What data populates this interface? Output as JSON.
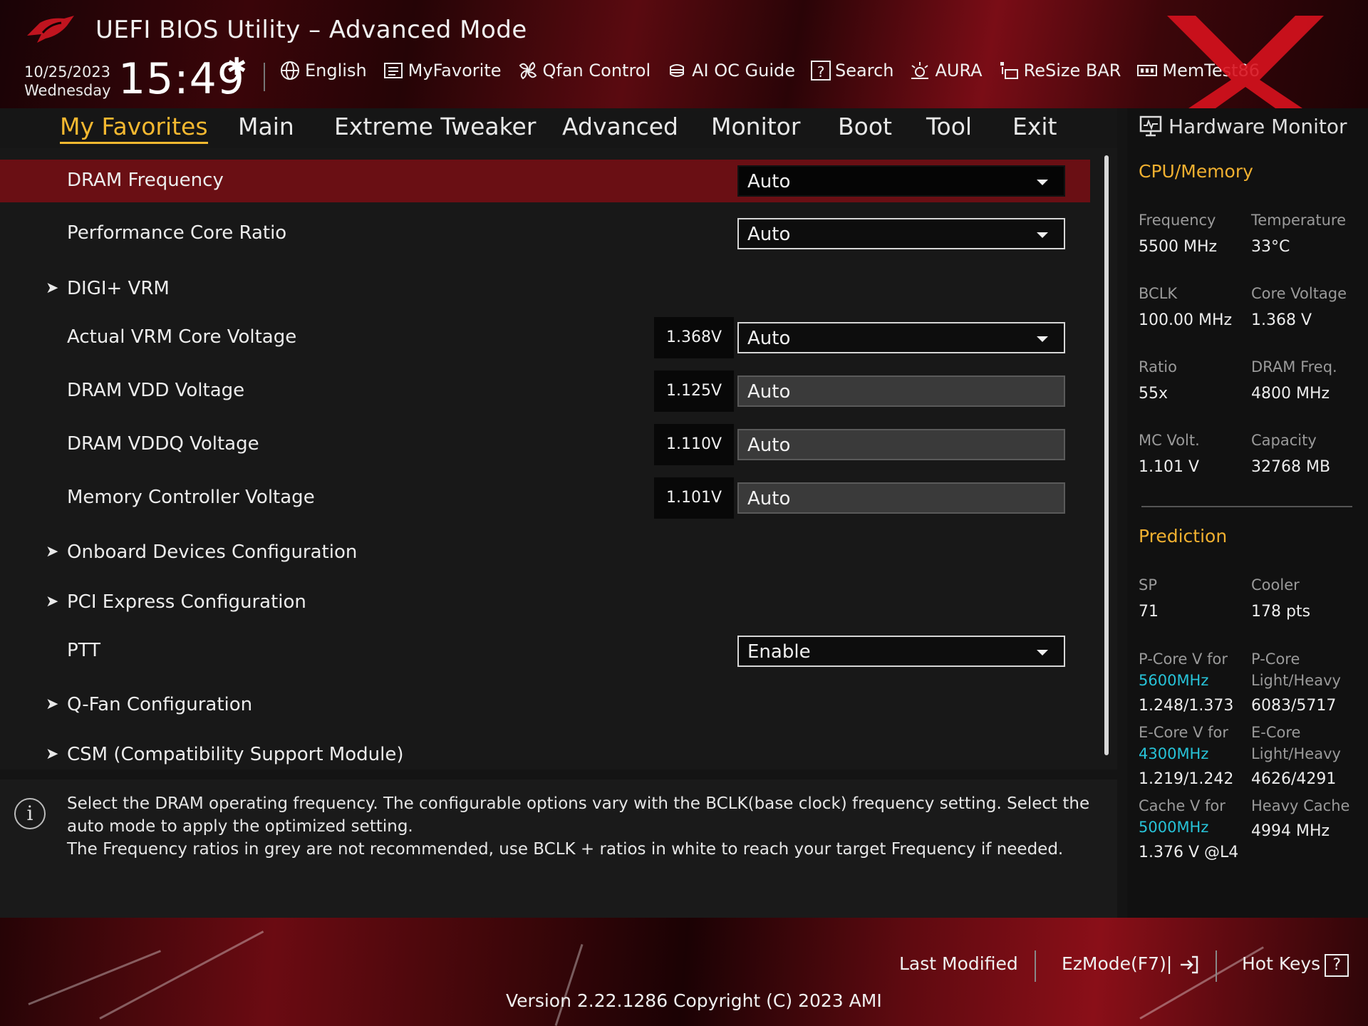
{
  "header": {
    "title": "UEFI BIOS Utility – Advanced Mode",
    "date": "10/25/2023",
    "weekday": "Wednesday",
    "time": "15:49",
    "toolbar": {
      "language": "English",
      "myfavorite": "MyFavorite",
      "qfan": "Qfan Control",
      "aioc": "AI OC Guide",
      "search": "Search",
      "aura": "AURA",
      "resizebar": "ReSize BAR",
      "memtest": "MemTest86"
    }
  },
  "tabs": [
    "My Favorites",
    "Main",
    "Extreme Tweaker",
    "Advanced",
    "Monitor",
    "Boot",
    "Tool",
    "Exit"
  ],
  "settings": {
    "dram_frequency": {
      "label": "DRAM Frequency",
      "value": "Auto"
    },
    "perf_core_ratio": {
      "label": "Performance Core Ratio",
      "value": "Auto"
    },
    "digi_vrm": {
      "label": "DIGI+ VRM"
    },
    "vrm_core_voltage": {
      "label": "Actual VRM Core Voltage",
      "reading": "1.368V",
      "value": "Auto"
    },
    "dram_vdd": {
      "label": "DRAM VDD Voltage",
      "reading": "1.125V",
      "value": "Auto"
    },
    "dram_vddq": {
      "label": "DRAM VDDQ Voltage",
      "reading": "1.110V",
      "value": "Auto"
    },
    "mc_voltage": {
      "label": "Memory Controller Voltage",
      "reading": "1.101V",
      "value": "Auto"
    },
    "onboard_devices": {
      "label": "Onboard Devices Configuration"
    },
    "pci_express": {
      "label": "PCI Express Configuration"
    },
    "ptt": {
      "label": "PTT",
      "value": "Enable"
    },
    "qfan_config": {
      "label": "Q-Fan Configuration"
    },
    "csm": {
      "label": "CSM (Compatibility Support Module)"
    }
  },
  "help": {
    "line1": "Select the DRAM operating frequency. The configurable options vary with the BCLK(base clock) frequency setting. Select the auto mode to apply the optimized setting.",
    "line2": "The Frequency ratios in grey are not recommended, use BCLK + ratios in white to reach your target Frequency if needed."
  },
  "hardware_monitor": {
    "title": "Hardware Monitor",
    "cpu_memory": {
      "heading": "CPU/Memory",
      "frequency_label": "Frequency",
      "frequency": "5500 MHz",
      "temperature_label": "Temperature",
      "temperature": "33°C",
      "bclk_label": "BCLK",
      "bclk": "100.00 MHz",
      "core_voltage_label": "Core Voltage",
      "core_voltage": "1.368 V",
      "ratio_label": "Ratio",
      "ratio": "55x",
      "dram_freq_label": "DRAM Freq.",
      "dram_freq": "4800 MHz",
      "mc_volt_label": "MC Volt.",
      "mc_volt": "1.101 V",
      "capacity_label": "Capacity",
      "capacity": "32768 MB"
    },
    "prediction": {
      "heading": "Prediction",
      "sp_label": "SP",
      "sp": "71",
      "cooler_label": "Cooler",
      "cooler": "178 pts",
      "pcore_v_label": "P-Core V for",
      "pcore_v_freq": "5600MHz",
      "pcore_v": "1.248/1.373",
      "pcore_lh_label_1": "P-Core",
      "pcore_lh_label_2": "Light/Heavy",
      "pcore_lh": "6083/5717",
      "ecore_v_label": "E-Core V for",
      "ecore_v_freq": "4300MHz",
      "ecore_v": "1.219/1.242",
      "ecore_lh_label_1": "E-Core",
      "ecore_lh_label_2": "Light/Heavy",
      "ecore_lh": "4626/4291",
      "cache_v_label": "Cache V for",
      "cache_v_freq": "5000MHz",
      "cache_v": "1.376 V @L4",
      "heavy_cache_label": "Heavy Cache",
      "heavy_cache": "4994 MHz"
    }
  },
  "footer": {
    "last_modified": "Last Modified",
    "ezmode": "EzMode(F7)|",
    "hotkeys": "Hot Keys",
    "hotkeys_icon": "?",
    "version": "Version 2.22.1286 Copyright (C) 2023 AMI"
  },
  "colors": {
    "accent": "#f5b830",
    "selected_row": "#6a0f14",
    "freq_highlight": "#27c3d8"
  },
  "icons": [
    "rog-logo",
    "gear-icon",
    "globe-icon",
    "favorite-icon",
    "fan-icon",
    "ai-oc-icon",
    "search-icon",
    "aura-icon",
    "resize-bar-icon",
    "memtest-icon",
    "monitor-icon",
    "info-icon",
    "ezmode-icon",
    "hotkeys-icon"
  ]
}
